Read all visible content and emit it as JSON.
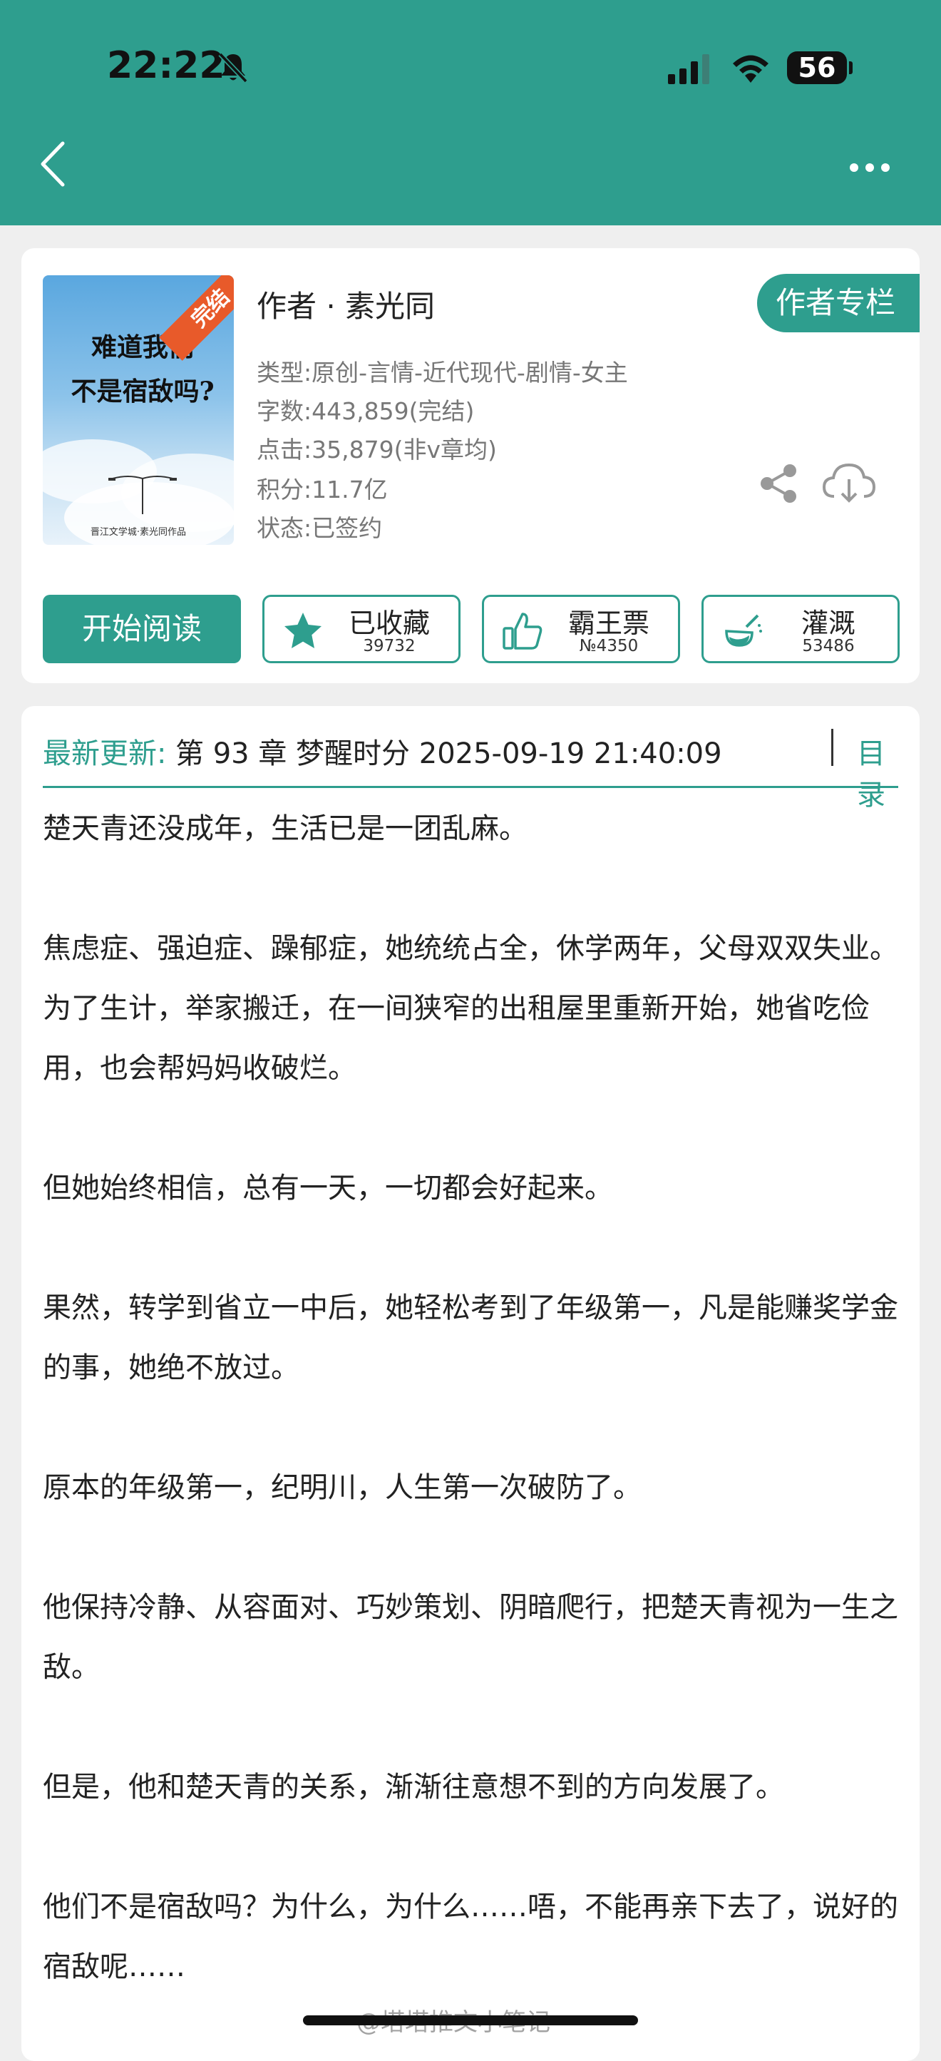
{
  "status_bar": {
    "time": "22:22",
    "battery": "56"
  },
  "book": {
    "cover_title_line1": "难道我们",
    "cover_title_line2": "不是宿敌吗?",
    "cover_publisher": "晋江文学城·素光同作品",
    "badge": "完结",
    "author": "作者 · 素光同",
    "author_column_label": "作者专栏",
    "type": "类型:原创-言情-近代现代-剧情-女主",
    "word_count": "字数:443,859(完结)",
    "clicks": "点击:35,879(非v章均)",
    "score": "积分:11.7亿",
    "status": "状态:已签约"
  },
  "actions": {
    "read": "开始阅读",
    "collect_label": "已收藏",
    "collect_count": "39732",
    "ticket_label": "霸王票",
    "ticket_count": "№4350",
    "water_label": "灌溉",
    "water_count": "53486"
  },
  "latest": {
    "label": "最新更新:",
    "text": "第 93 章 梦醒时分 2025-09-19 21:40:09",
    "toc_label": "目录"
  },
  "summary": [
    "楚天青还没成年，生活已是一团乱麻。",
    "焦虑症、强迫症、躁郁症，她统统占全，休学两年，父母双双失业。为了生计，举家搬迁，在一间狭窄的出租屋里重新开始，她省吃俭用，也会帮妈妈收破烂。",
    "但她始终相信，总有一天，一切都会好起来。",
    "果然，转学到省立一中后，她轻松考到了年级第一，凡是能赚奖学金的事，她绝不放过。",
    "原本的年级第一，纪明川，人生第一次破防了。",
    "他保持冷静、从容面对、巧妙策划、阴暗爬行，把楚天青视为一生之敌。",
    "但是，他和楚天青的关系，渐渐往意想不到的方向发展了。",
    "他们不是宿敌吗？为什么，为什么……唔，不能再亲下去了，说好的宿敌呢……"
  ],
  "watermark": "@塔塔推文小笔记",
  "colors": {
    "accent": "#2e9e8e",
    "badge": "#e85a2a",
    "background": "#efefef"
  },
  "icons": [
    "back-arrow-icon",
    "more-icon",
    "share-icon",
    "download-cloud-icon",
    "star-icon",
    "thumbs-up-icon",
    "watering-can-icon"
  ]
}
